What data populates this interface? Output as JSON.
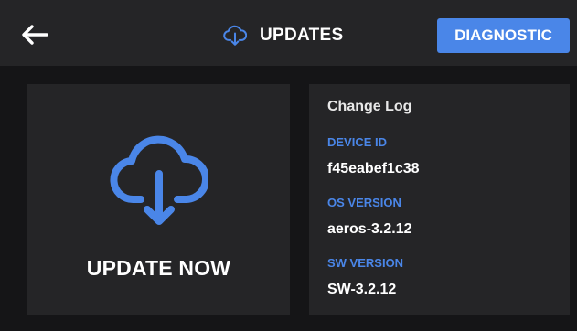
{
  "header": {
    "back_icon": "arrow-left-icon",
    "title_icon": "cloud-download-icon",
    "title": "UPDATES",
    "diagnostic_label": "DIAGNOSTIC",
    "accent_color": "#4a86e8"
  },
  "update_card": {
    "icon": "cloud-download-icon",
    "label": "UPDATE NOW"
  },
  "info": {
    "changelog_label": "Change Log",
    "device_id_label": "DEVICE ID",
    "device_id_value": "f45eabef1c38",
    "os_version_label": "OS VERSION",
    "os_version_value": "aeros-3.2.12",
    "sw_version_label": "SW VERSION",
    "sw_version_value": "SW-3.2.12"
  }
}
